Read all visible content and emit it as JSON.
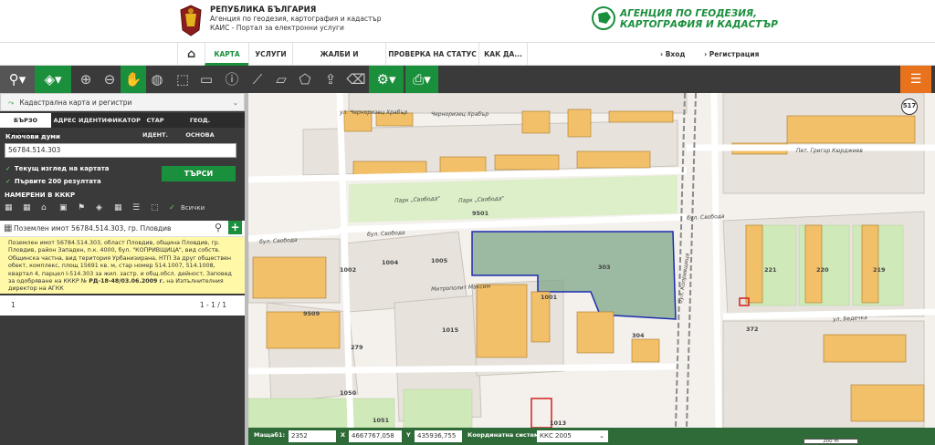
{
  "header": {
    "agency_title": "РЕПУБЛИКА БЪЛГАРИЯ",
    "agency_line2": "Агенция по геодезия, картография и кадастър",
    "agency_line3": "КАИС - Портал за електронни услуги",
    "brand_line1": "АГЕНЦИЯ ПО ГЕОДЕЗИЯ,",
    "brand_line2": "КАРТОГРАФИЯ И КАДАСТЪР"
  },
  "nav": {
    "items": [
      "КАРТА",
      "УСЛУГИ",
      "ЖАЛБИ И ВЪЗРАЖЕНИЯ",
      "ПРОВЕРКА НА СТАТУС",
      "КАК ДА..."
    ],
    "login": "Вход",
    "register": "Регистрация"
  },
  "panel": {
    "title": "Кадастрална карта и регистри",
    "tabs": [
      "БЪРЗО ТЪРСЕНЕ",
      "АДРЕС",
      "ИДЕНТИФИКАТОР",
      "СТАР ИДЕНТ.",
      "ГЕОД. ОСНОВА"
    ],
    "keywords_label": "Ключови думи",
    "keywords_value": "56784.514.303",
    "check_current_view": "Текущ изглед на картата",
    "check_first_200": "Първите 200 резултата",
    "search_button": "ТЪРСИ",
    "found_label": "НАМЕРЕНИ В КККР",
    "filter_all": "Всички",
    "result_title": "Поземлен имот 56784.514.303, гр. Пловдив",
    "result_text": "Поземлен имот 56784.514.303, област Пловдив, община Пловдив, гр. Пловдив, район Западен, п.к. 4000, бул. \"КОПРИВЩИЦА\", вид собств. Общинска частна, вид територия Урбанизирана, НТП За друг обществен обект, комплекс, площ 15691 кв. м, стар номер 514.1007, 514.1008, квартал 4, парцел I-514.303 за жил. застр. и общ.обсл. дейност,",
    "result_order_prefix": "Заповед за одобряване на КККР № ",
    "result_order_number": "РД-18-48/03.06.2009 г.",
    "result_order_suffix": " на Изпълнителния директор на АГКК",
    "page_number": "1",
    "result_count": "1 - 1 / 1"
  },
  "map": {
    "street_labels": [
      "бул. Свобода",
      "бул. Свобода",
      "бул. Свобода",
      "Парк „Свобода\"",
      "Парк „Свобода\"",
      "бул. Копривщица",
      "Митрополит Максим",
      "ул. Бедечка",
      "Пет. Григор Кюрджиев",
      "ул. Черноризец Храбър",
      "Черноризец Храбър"
    ],
    "parcel_labels": [
      "9501",
      "1004",
      "1005",
      "1002",
      "1015",
      "303",
      "221",
      "220",
      "219",
      "279",
      "1051",
      "1050",
      "9509",
      "1001",
      "304",
      "372",
      "1013"
    ],
    "zoom_badge": "517"
  },
  "status_bar": {
    "scale_label": "Мащаб",
    "scale_value": "2352",
    "x_label": "X",
    "x_value": "4667767,058",
    "y_label": "Y",
    "y_value": "435936,755",
    "crs_label": "Координатна система",
    "crs_value": "ККС 2005",
    "scale_bar_text": "200 m"
  }
}
